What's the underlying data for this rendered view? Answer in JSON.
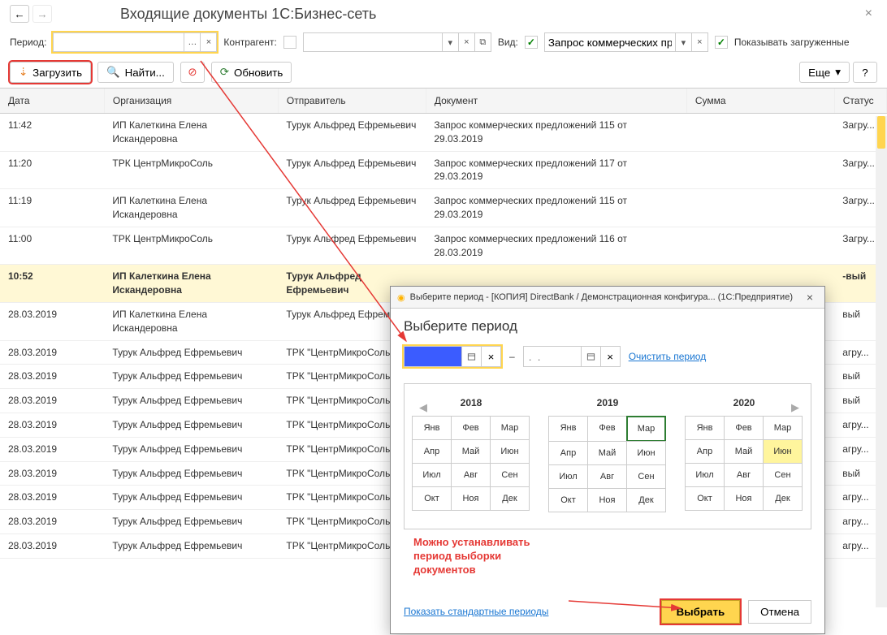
{
  "title": "Входящие документы 1С:Бизнес-сеть",
  "filters": {
    "period_label": "Период:",
    "contragent_label": "Контрагент:",
    "view_label": "Вид:",
    "view_value": "Запрос коммерческих пред",
    "show_loaded_label": "Показывать загруженные"
  },
  "toolbar": {
    "load": "Загрузить",
    "find": "Найти...",
    "refresh": "Обновить",
    "more": "Еще"
  },
  "columns": {
    "date": "Дата",
    "org": "Организация",
    "sender": "Отправитель",
    "doc": "Документ",
    "sum": "Сумма",
    "status": "Статус"
  },
  "rows": [
    {
      "date": "11:42",
      "org": "ИП Калеткина Елена Искандеровна",
      "sender": "Турук Альфред Ефремьевич",
      "doc": "Запрос коммерческих предложений 115 от 29.03.2019",
      "sum": "",
      "status": "Загру..."
    },
    {
      "date": "11:20",
      "org": "ТРК ЦентрМикроСоль",
      "sender": "Турук Альфред Ефремьевич",
      "doc": "Запрос коммерческих предложений 117 от 29.03.2019",
      "sum": "",
      "status": "Загру..."
    },
    {
      "date": "11:19",
      "org": "ИП Калеткина Елена Искандеровна",
      "sender": "Турук Альфред Ефремьевич",
      "doc": "Запрос коммерческих предложений 115 от 29.03.2019",
      "sum": "",
      "status": "Загру..."
    },
    {
      "date": "11:00",
      "org": "ТРК ЦентрМикроСоль",
      "sender": "Турук Альфред Ефремьевич",
      "doc": "Запрос коммерческих предложений 116 от 28.03.2019",
      "sum": "",
      "status": "Загру..."
    },
    {
      "date": "10:52",
      "org": "ИП Калеткина Елена Искандеровна",
      "sender": "Турук Альфред Ефремьевич",
      "doc": "",
      "sum": "",
      "status": "-вый",
      "selected": true
    },
    {
      "date": "28.03.2019",
      "org": "ИП Калеткина Елена Искандеровна",
      "sender": "Турук Альфред Ефремьевич",
      "doc": "",
      "sum": "",
      "status": "вый"
    },
    {
      "date": "28.03.2019",
      "org": "Турук Альфред Ефремьевич",
      "sender": "ТРК \"ЦентрМикроСоль\"",
      "doc": "",
      "sum": "",
      "status": "агру..."
    },
    {
      "date": "28.03.2019",
      "org": "Турук Альфред Ефремьевич",
      "sender": "ТРК \"ЦентрМикроСоль\"",
      "doc": "",
      "sum": "",
      "status": "вый"
    },
    {
      "date": "28.03.2019",
      "org": "Турук Альфред Ефремьевич",
      "sender": "ТРК \"ЦентрМикроСоль\"",
      "doc": "",
      "sum": "",
      "status": "вый"
    },
    {
      "date": "28.03.2019",
      "org": "Турук Альфред Ефремьевич",
      "sender": "ТРК \"ЦентрМикроСоль\"",
      "doc": "",
      "sum": "",
      "status": "агру..."
    },
    {
      "date": "28.03.2019",
      "org": "Турук Альфред Ефремьевич",
      "sender": "ТРК \"ЦентрМикроСоль\"",
      "doc": "",
      "sum": "",
      "status": "агру..."
    },
    {
      "date": "28.03.2019",
      "org": "Турук Альфред Ефремьевич",
      "sender": "ТРК \"ЦентрМикроСоль\"",
      "doc": "",
      "sum": "",
      "status": "вый"
    },
    {
      "date": "28.03.2019",
      "org": "Турук Альфред Ефремьевич",
      "sender": "ТРК \"ЦентрМикроСоль\"",
      "doc": "",
      "sum": "",
      "status": "агру..."
    },
    {
      "date": "28.03.2019",
      "org": "Турук Альфред Ефремьевич",
      "sender": "ТРК \"ЦентрМикроСоль\"",
      "doc": "",
      "sum": "",
      "status": "агру..."
    },
    {
      "date": "28.03.2019",
      "org": "Турук Альфред Ефремьевич",
      "sender": "ТРК \"ЦентрМикроСоль\"",
      "doc": "",
      "sum": "",
      "status": "агру..."
    }
  ],
  "dialog": {
    "window_title": "Выберите период - [КОПИЯ] DirectBank / Демонстрационная конфигура... (1С:Предприятие)",
    "heading": "Выберите период",
    "dash": "–",
    "to_placeholder": ".  .",
    "clear": "Очистить период",
    "years": [
      "2018",
      "2019",
      "2020"
    ],
    "months": [
      "Янв",
      "Фев",
      "Мар",
      "Апр",
      "Май",
      "Июн",
      "Июл",
      "Авг",
      "Сен",
      "Окт",
      "Ноя",
      "Дек"
    ],
    "current_year": 1,
    "current_month": 2,
    "sel_year": 2,
    "sel_month": 5,
    "std_periods": "Показать стандартные периоды",
    "select": "Выбрать",
    "cancel": "Отмена"
  },
  "annotation": "Можно устанавливать\nпериод выборки\nдокументов"
}
